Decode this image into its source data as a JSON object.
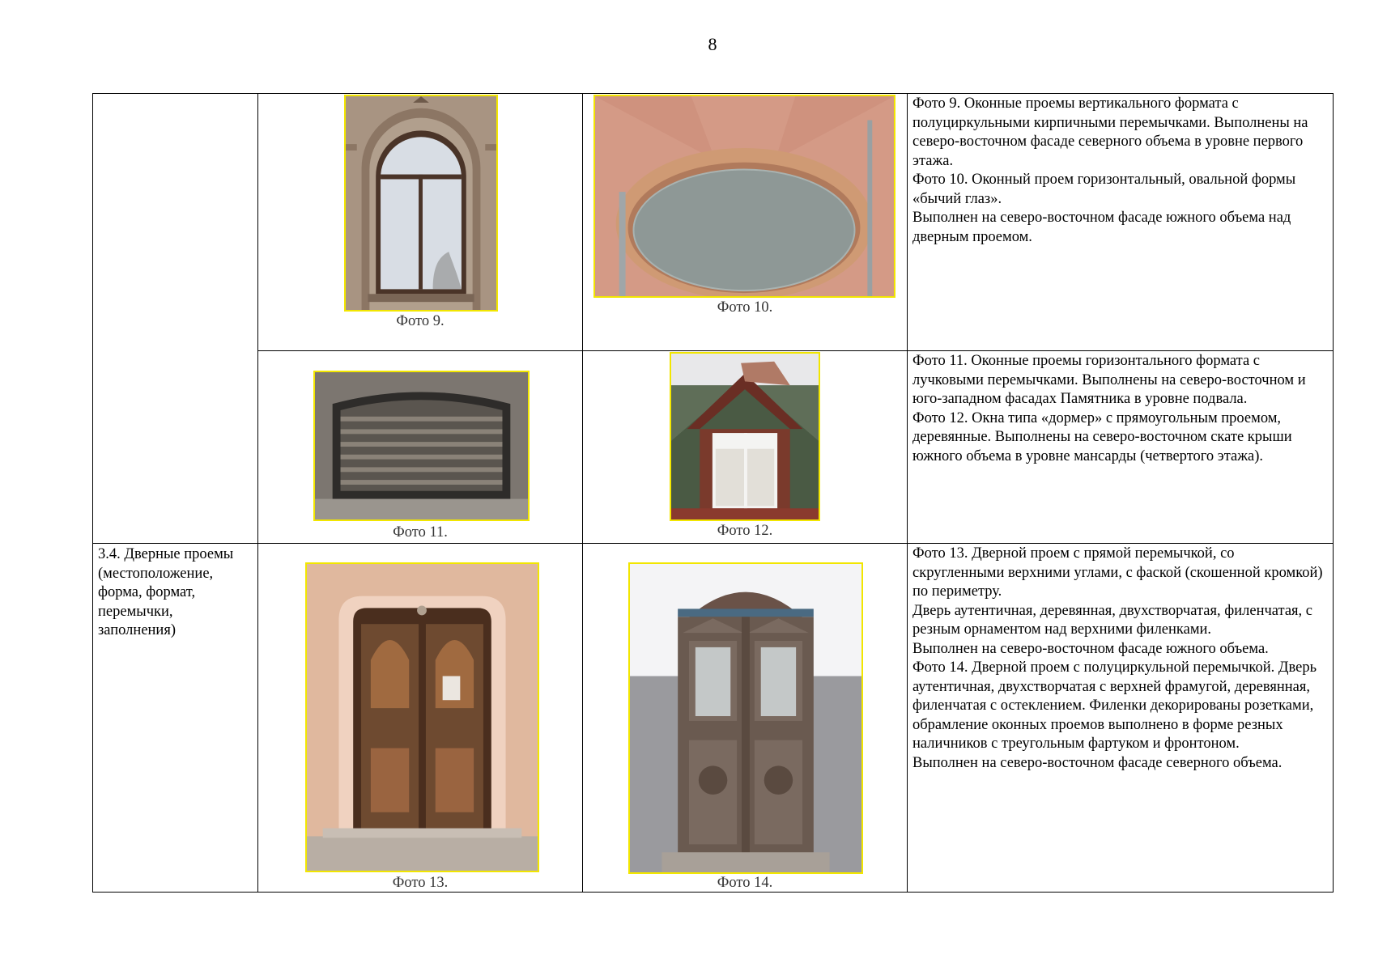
{
  "page_number": "8",
  "colors": {
    "frame": "#f2e600",
    "border": "#000000"
  },
  "rows": [
    {
      "label": "",
      "photos": [
        {
          "caption": "Фото 9.",
          "icon": "arched-window"
        },
        {
          "caption": "Фото 10.",
          "icon": "oval-bulls-eye-window"
        }
      ],
      "description": [
        "Фото 9.  Оконные проемы вертикального формата с полуциркульными кирпичными перемычками. Выполнены на северо-восточном фасаде северного объема в уровне первого этажа.",
        "Фото 10. Оконный проем горизонтальный, овальной формы «бычий глаз».",
        "Выполнен на северо-восточном фасаде южного объема над дверным проемом."
      ]
    },
    {
      "label": "",
      "photos": [
        {
          "caption": "Фото 11.",
          "icon": "basement-grille-window"
        },
        {
          "caption": "Фото 12.",
          "icon": "dormer-window"
        }
      ],
      "description": [
        "Фото 11. Оконные проемы горизонтального формата с лучковыми перемычками. Выполнены на северо-восточном и юго-западном фасадах Памятника в уровне подвала.",
        "Фото 12. Окна типа «дормер» с прямоугольным проемом, деревянные. Выполнены на северо-восточном скате крыши южного объема в уровне мансарды (четвертого этажа)."
      ]
    },
    {
      "label": "3.4. Дверные проемы (местоположение, форма, формат, перемычки, заполнения)",
      "photos": [
        {
          "caption": "Фото 13.",
          "icon": "wooden-double-door"
        },
        {
          "caption": "Фото 14.",
          "icon": "arched-double-door"
        }
      ],
      "description": [
        "Фото 13.  Дверной проем с прямой перемычкой, со скругленными верхними углами, с фаской (скошенной кромкой) по периметру.",
        "Дверь аутентичная, деревянная, двухстворчатая, филенчатая, с резным орнаментом над верхними филенками.",
        "Выполнен на северо-восточном фасаде южного объема.",
        "Фото 14. Дверной проем с полуциркульной перемычкой. Дверь аутентичная, двухстворчатая с верхней фрамугой, деревянная, филенчатая с остеклением. Филенки декорированы розетками, обрамление оконных проемов выполнено в форме резных наличников с треугольным фартуком и фронтоном.",
        "Выполнен на северо-восточном фасаде северного объема."
      ]
    }
  ]
}
